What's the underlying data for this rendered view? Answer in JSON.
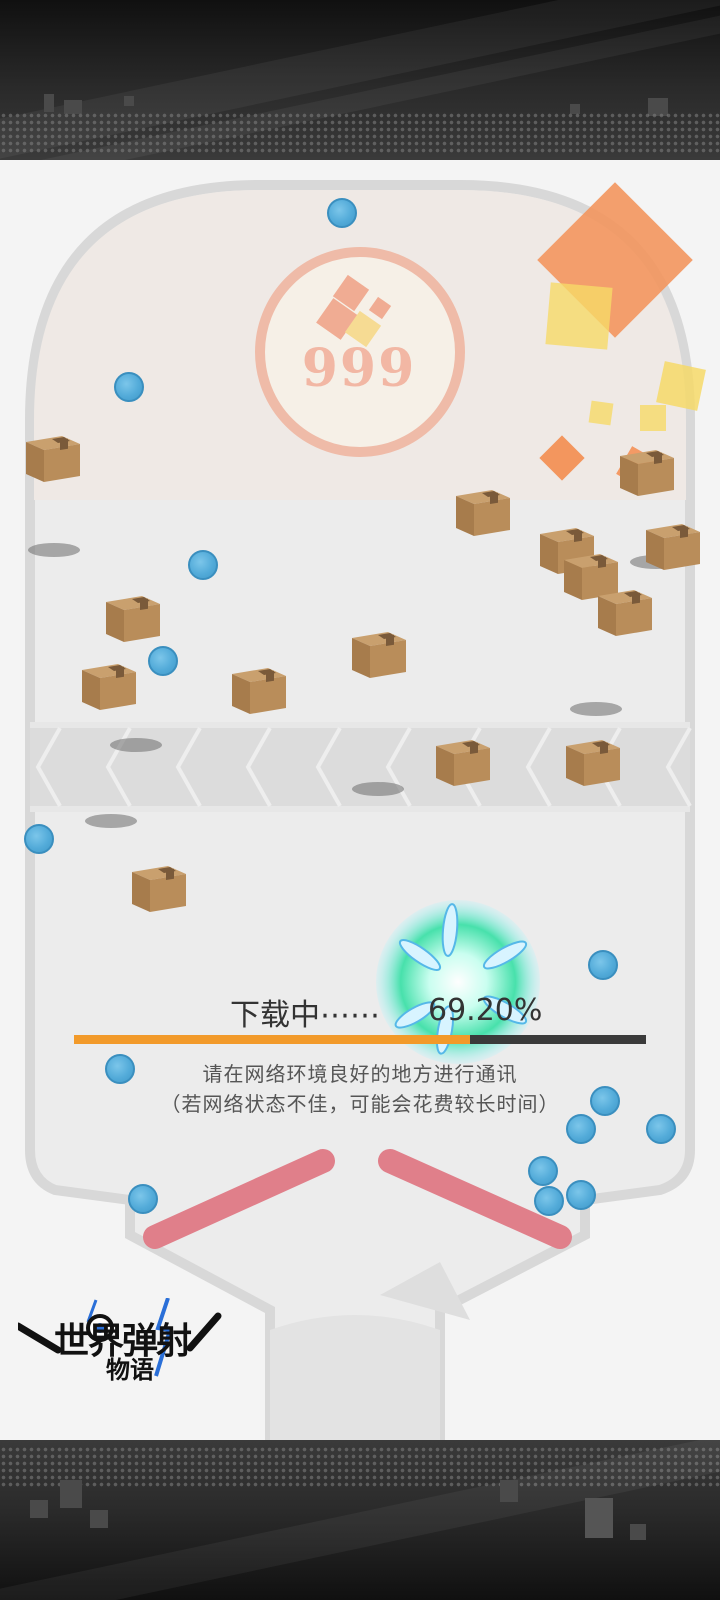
{
  "score": "999",
  "download": {
    "label": "下载中⋯⋯",
    "percent_text": "69.20%",
    "progress": 0.692
  },
  "notice": {
    "line1": "请在网络环境良好的地方进行通讯",
    "line2": "（若网络状态不佳，可能会花费较长时间）"
  },
  "logo": {
    "title": "世界弹射",
    "subtitle": "物语"
  },
  "colors": {
    "progress_fill": "#f29a2a",
    "progress_track": "#3a3a3a",
    "ball": "#53abd9",
    "flipper": "#e07f8a",
    "score_ring": "#f0b7a2"
  }
}
